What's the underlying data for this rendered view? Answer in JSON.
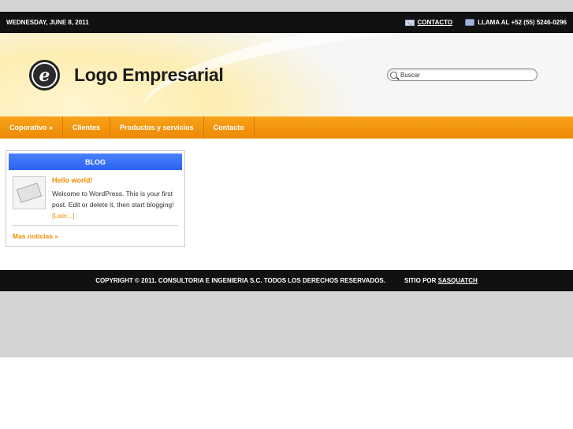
{
  "topbar": {
    "date": "WEDNESDAY, JUNE 8, 2011",
    "contact_label": "CONTACTO",
    "phone_text": "LLAMA AL +52 (55) 5246-0296"
  },
  "header": {
    "logo_letter": "e",
    "logo_text": "Logo Empresarial",
    "search_placeholder": "Buscar"
  },
  "nav": {
    "items": [
      {
        "label": "Coporativo »"
      },
      {
        "label": "Clientes"
      },
      {
        "label": "Productos y servicios"
      },
      {
        "label": "Contacto"
      }
    ]
  },
  "blog": {
    "heading": "BLOG",
    "post_title": "Hello world!",
    "post_excerpt": "Welcome to WordPress. This is your first post. Edit or delete it, then start blogging!",
    "read_more": "[Leer...]",
    "more_news": "Mas noticias »"
  },
  "footer": {
    "copyright": "COPYRIGHT © 2011. CONSULTORIA E INGENIERIA S.C. TODOS LOS DERECHOS RESERVADOS.",
    "site_by_label": "SITIO POR",
    "site_by_link": "SASQUATCH"
  },
  "colors": {
    "accent_orange": "#f08c00",
    "nav_orange": "#f39510",
    "blog_blue": "#3a72f8",
    "bar_black": "#111111"
  },
  "icons": {
    "contact": "mail-icon",
    "phone": "phone-icon",
    "search": "search-icon"
  }
}
